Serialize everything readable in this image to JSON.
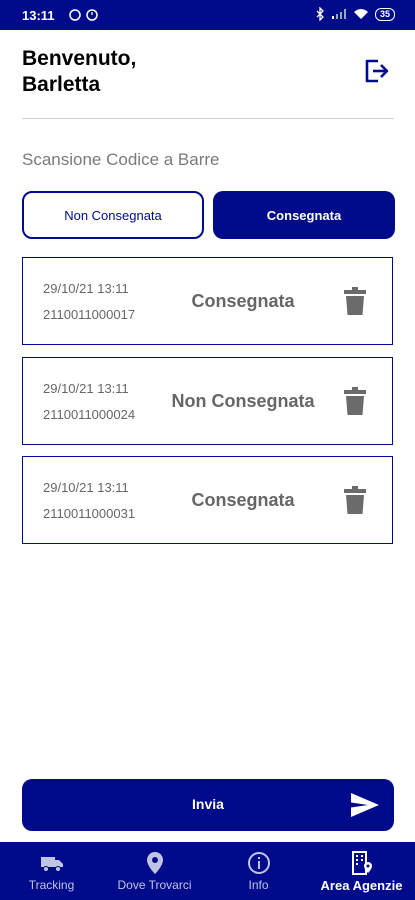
{
  "status_bar": {
    "time": "13:11",
    "battery": "35"
  },
  "header": {
    "title_line1": "Benvenuto,",
    "title_line2": "Barletta"
  },
  "section": {
    "title": "Scansione Codice a Barre"
  },
  "toggle": {
    "non_consegnata": "Non Consegnata",
    "consegnata": "Consegnata"
  },
  "items": [
    {
      "date": "29/10/21  13:11",
      "code": "2110011000017",
      "status": "Consegnata"
    },
    {
      "date": "29/10/21  13:11",
      "code": "2110011000024",
      "status": "Non Consegnata"
    },
    {
      "date": "29/10/21  13:11",
      "code": "2110011000031",
      "status": "Consegnata"
    }
  ],
  "send_button": {
    "label": "Invia",
    "icon": "send-icon"
  },
  "nav": [
    {
      "label": "Tracking",
      "icon": "truck-icon"
    },
    {
      "label": "Dove Trovarci",
      "icon": "location-pin-icon"
    },
    {
      "label": "Info",
      "icon": "info-icon"
    },
    {
      "label": "Area Agenzie",
      "icon": "building-icon"
    }
  ],
  "colors": {
    "primary": "#000b8c",
    "text_muted": "#666666",
    "divider": "#d0d0d0"
  }
}
